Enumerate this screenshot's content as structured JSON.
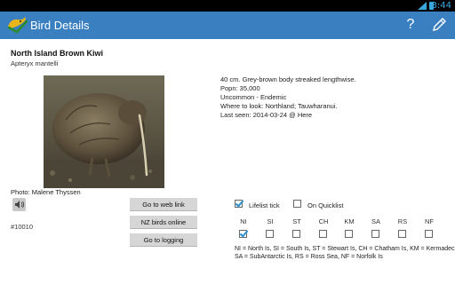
{
  "status_bar": {
    "time": "3:44"
  },
  "app_bar": {
    "title": "Bird Details",
    "help_icon": "help-icon",
    "edit_icon": "pencil-icon",
    "brand_color": "#3a80c0"
  },
  "bird": {
    "common_name": "North Island Brown Kiwi",
    "latin_name": "Apteryx mantelli"
  },
  "photo": {
    "credit": "Photo: Malene Thyssen"
  },
  "sound_icon": "speaker-icon",
  "ref_number": "#10010",
  "description": {
    "line1": "40 cm.  Grey-brown body streaked lengthwise.",
    "line2": "Popn: 35,000",
    "line3": "Uncommon - Endemic",
    "line4": "Where to look: Northland; Tauwharanui.",
    "line5": "Last seen: 2014-03-24 @ Here"
  },
  "buttons": {
    "web": "Go  to  web link",
    "nzbirds": "NZ birds online",
    "logging": "Go to logging"
  },
  "lists": {
    "lifelist_label": "Lifelist tick",
    "lifelist_checked": true,
    "quicklist_label": "On Quicklist",
    "quicklist_checked": false
  },
  "islands": [
    {
      "code": "NI",
      "checked": true
    },
    {
      "code": "SI",
      "checked": false
    },
    {
      "code": "ST",
      "checked": false
    },
    {
      "code": "CH",
      "checked": false
    },
    {
      "code": "KM",
      "checked": false
    },
    {
      "code": "SA",
      "checked": false
    },
    {
      "code": "RS",
      "checked": false
    },
    {
      "code": "NF",
      "checked": false
    }
  ],
  "legend": {
    "line1": "NI = North Is, SI = South Is, ST = Stewart Is, CH = Chatham Is, KM = Kermadecs",
    "line2": "SA = SubAntarctic Is, RS = Ross Sea, NF = Norfolk Is"
  }
}
